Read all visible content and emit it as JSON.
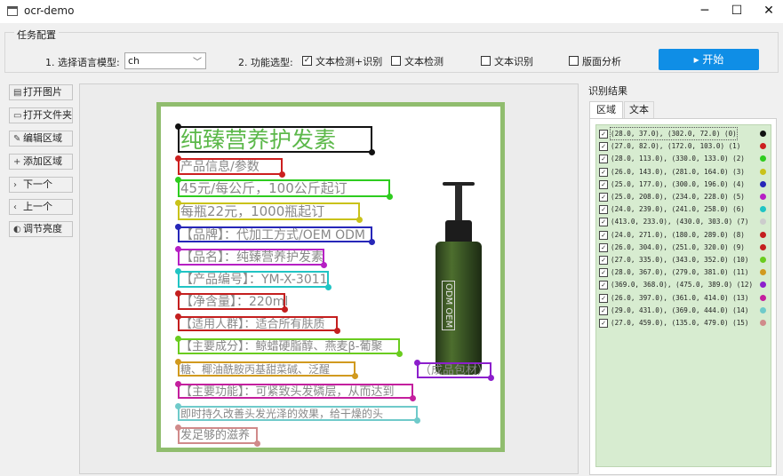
{
  "window": {
    "title": "ocr-demo",
    "minimize": "─",
    "maximize": "☐",
    "close": "✕"
  },
  "config": {
    "group_title": "任务配置",
    "lang_label": "1. 选择语言模型:",
    "lang_value": "ch",
    "func_label": "2. 功能选型:",
    "options": [
      {
        "label": "文本检测+识别",
        "checked": true
      },
      {
        "label": "文本检测",
        "checked": false
      },
      {
        "label": "文本识别",
        "checked": false
      },
      {
        "label": "版面分析",
        "checked": false
      }
    ],
    "start_label": "开始"
  },
  "toolbar": [
    {
      "label": "打开图片",
      "icon": "image-icon"
    },
    {
      "label": "打开文件夹",
      "icon": "folder-icon"
    },
    {
      "label": "编辑区域",
      "icon": "pencil-icon"
    },
    {
      "label": "添加区域",
      "icon": "plus-icon"
    },
    {
      "label": "下一个",
      "icon": "chevron-right-icon"
    },
    {
      "label": "上一个",
      "icon": "chevron-left-icon"
    },
    {
      "label": "调节亮度",
      "icon": "brightness-icon"
    }
  ],
  "ocr_regions": [
    {
      "text": "纯臻营养护发素",
      "color": "#111111"
    },
    {
      "text": "产品信息/参数",
      "color": "#cc1f1f"
    },
    {
      "text": "45元/每公斤，100公斤起订",
      "color": "#2ecc1f"
    },
    {
      "text": "每瓶22元，1000瓶起订",
      "color": "#c9c21a"
    },
    {
      "text": "【品牌】：代加工方式/OEM ODM",
      "color": "#2727b8"
    },
    {
      "text": "【品名】：纯臻营养护发素",
      "color": "#b61fc4"
    },
    {
      "text": "【产品编号】：YM-X-3011",
      "color": "#21c4c4"
    },
    {
      "text": "ODM OEM",
      "color": "#cccccc"
    },
    {
      "text": "【净含量】：220ml",
      "color": "#c41f1f"
    },
    {
      "text": "【适用人群】：适合所有肤质",
      "color": "#c41f1f"
    },
    {
      "text": "【主要成分】：鲸蜡硬脂醇、燕麦β-葡聚",
      "color": "#6acc1f"
    },
    {
      "text": "糖、椰油酰胺丙基甜菜碱、泛醒",
      "color": "#d19a1f"
    },
    {
      "text": "（成品包材）",
      "color": "#8c1fcc"
    },
    {
      "text": "【主要功能】：可紧致头发磷层，从而达到",
      "color": "#c41f9e"
    },
    {
      "text": "即时持久改善头发光泽的效果，给干燥的头",
      "color": "#6fcaca"
    },
    {
      "text": "发足够的滋养",
      "color": "#d08a8a"
    }
  ],
  "result_panel": {
    "title": "识别结果",
    "tabs": [
      "区域",
      "文本"
    ],
    "items": [
      "(28.0, 37.0), (302.0, 72.0) (0)",
      "(27.0, 82.0), (172.0, 103.0) (1)",
      "(28.0, 113.0), (330.0, 133.0) (2)",
      "(26.0, 143.0), (281.0, 164.0) (3)",
      "(25.0, 177.0), (300.0, 196.0) (4)",
      "(25.0, 208.0), (234.0, 228.0) (5)",
      "(24.0, 239.0), (241.0, 258.0) (6)",
      "(413.0, 233.0), (430.0, 303.0) (7)",
      "(24.0, 271.0), (180.0, 289.0) (8)",
      "(26.0, 304.0), (251.0, 320.0) (9)",
      "(27.0, 335.0), (343.0, 352.0) (10)",
      "(28.0, 367.0), (279.0, 381.0) (11)",
      "(369.0, 368.0), (475.0, 389.0) (12)",
      "(26.0, 397.0), (361.0, 414.0) (13)",
      "(29.0, 431.0), (369.0, 444.0) (14)",
      "(27.0, 459.0), (135.0, 479.0) (15)"
    ]
  }
}
